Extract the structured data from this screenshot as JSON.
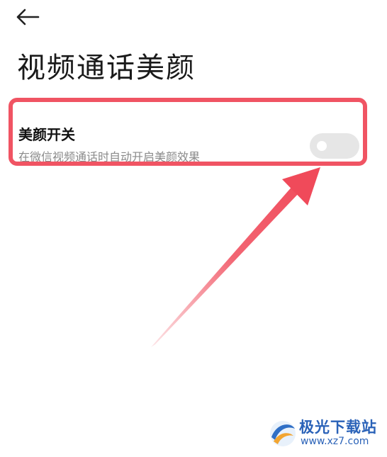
{
  "header": {
    "back_icon": "arrow-left-icon",
    "title": "视频通话美颜"
  },
  "setting": {
    "title": "美颜开关",
    "description": "在微信视频通话时自动开启美颜效果",
    "toggle_on": false
  },
  "annotation": {
    "highlight_color": "#f05463",
    "arrow_color": "#f04a5a"
  },
  "watermark": {
    "brand": "极光下载站",
    "url": "www.xz7.com",
    "color": "#2a62b8"
  }
}
